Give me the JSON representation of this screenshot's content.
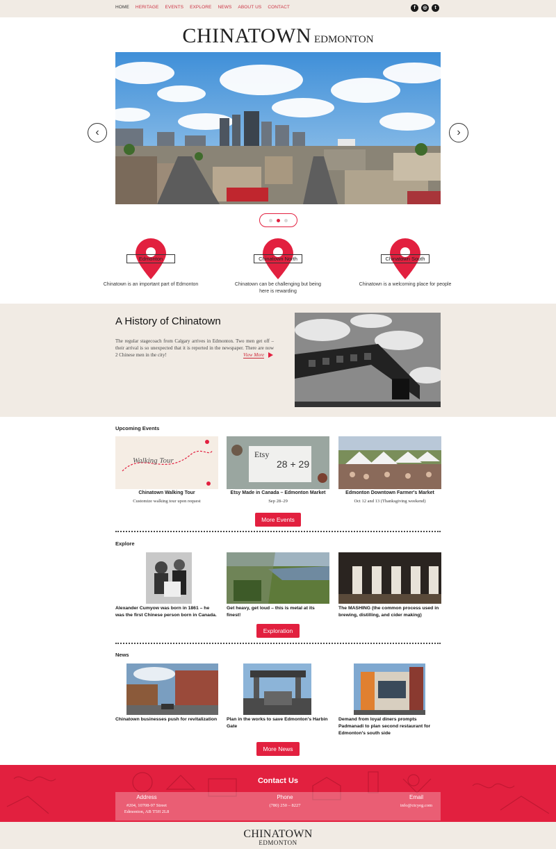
{
  "nav": {
    "items": [
      "HOME",
      "HERITAGE",
      "EVENTS",
      "EXPLORE",
      "NEWS",
      "ABOUT US",
      "CONTACT"
    ],
    "active": "HOME"
  },
  "social": {
    "icons": [
      "facebook-icon",
      "instagram-icon",
      "twitter-icon"
    ],
    "glyphs": [
      "f",
      "◎",
      "t"
    ]
  },
  "brand": {
    "title": "CHINATOWN",
    "subtitle": "EDMONTON"
  },
  "slider": {
    "prev": "‹",
    "next": "›",
    "slide_count": 3,
    "active_slide": 2
  },
  "features": [
    {
      "label": "Edmonton",
      "text": "Chinatown is an important part of Edmonton"
    },
    {
      "label": "Chinatown North",
      "text": "Chinatown can be challenging but being here is rewarding"
    },
    {
      "label": "Chinatown South",
      "text": "Chinatown is a welcoming place for people"
    }
  ],
  "history": {
    "heading": "A History of Chinatown",
    "body": "The regular stagecoach from Calgary arrives in Edmonton. Two men get off – their arrival is so unexpected that it is reported in the newspaper. There are now 2 Chinese men in the city!",
    "link": "View More"
  },
  "events": {
    "heading": "Upcoming Events",
    "items": [
      {
        "title": "Chinatown Walking Tour",
        "sub": "Customize walking tour upon request"
      },
      {
        "title": "Etsy Made in Canada – Edmonton Market",
        "sub": "Sep 28–29"
      },
      {
        "title": "Edmonton Downtown Farmer's Market",
        "sub": "Oct 12 and 13 (Thanksgiving weekend)"
      }
    ],
    "button": "More Events"
  },
  "explore": {
    "heading": "Explore",
    "items": [
      {
        "title": "Alexander Cumyow was born in 1861 – he was the first Chinese person born in Canada."
      },
      {
        "title": "Get heavy, get loud – this is metal at its finest!"
      },
      {
        "title": "The MASHING (the common process used in brewing, distilling, and cider making)"
      }
    ],
    "button": "Exploration"
  },
  "news": {
    "heading": "News",
    "items": [
      {
        "title": "Chinatown businesses push for revitalization"
      },
      {
        "title": "Plan in the works to save Edmonton's Harbin Gate"
      },
      {
        "title": "Demand from loyal diners prompts Padmanadi to plan second restaurant for Edmonton's south side"
      }
    ],
    "button": "More News"
  },
  "contact": {
    "heading": "Contact Us",
    "address_label": "Address",
    "address_line1": "#204, 10708-97 Street",
    "address_line2": "Edmonton, AB T5H 2L8",
    "phone_label": "Phone",
    "phone": "(780) 250 – 8227",
    "email_label": "Email",
    "email": "info@ctcyeg.com"
  },
  "footer": {
    "title": "CHINATOWN",
    "subtitle": "EDMONTON"
  },
  "colors": {
    "accent": "#e2203f",
    "beige": "#f1ebe4"
  }
}
